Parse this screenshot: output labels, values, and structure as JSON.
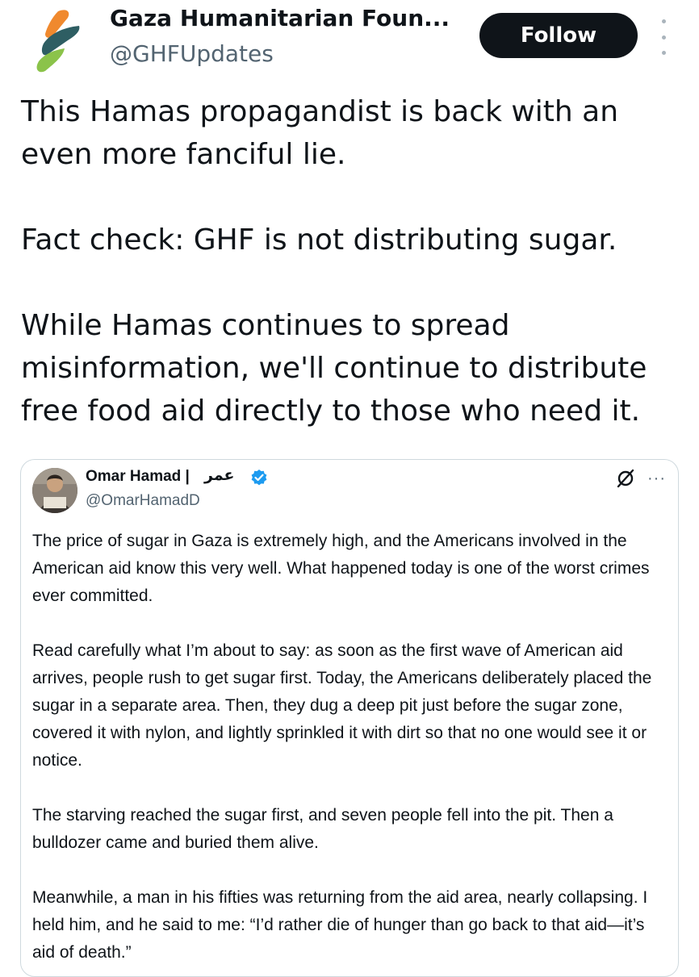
{
  "post": {
    "author": {
      "name": "Gaza Humanitarian Foun...",
      "handle": "@GHFUpdates"
    },
    "follow_label": "Follow",
    "paragraphs": [
      "This Hamas propagandist is back with an even more fanciful lie.",
      "Fact check: GHF is not distributing sugar.",
      "While Hamas continues to spread misinformation, we'll continue to distribute free food aid directly to those who need it."
    ]
  },
  "quoted": {
    "author": {
      "name": "Omar Hamad |",
      "name_arabic": "عمر",
      "handle": "@OmarHamadD"
    },
    "more_label": "···",
    "paragraphs": [
      "The price of sugar in Gaza is extremely high, and the Americans involved in the American aid know this very well. What happened today is one of the worst crimes ever committed.",
      "Read carefully what I’m about to say: as soon as the first wave of American aid arrives, people rush to get sugar first. Today, the Americans deliberately placed the sugar in a separate area. Then, they dug a deep pit just before the sugar zone, covered it with nylon, and lightly sprinkled it with dirt so that no one would see it or notice.",
      "The starving reached the sugar first, and seven people fell into the pit. Then a bulldozer came and buried them alive.",
      "Meanwhile, a man in his fifties was returning from the aid area, nearly collapsing. I held him, and he said to me: “I’d rather die of hunger than go back to that aid—it’s aid of death.”"
    ]
  },
  "colors": {
    "primary_text": "#0f1419",
    "secondary_text": "#536471",
    "verified_blue": "#1d9bf0",
    "logo_orange": "#f0892e",
    "logo_teal": "#2e5e63",
    "logo_green": "#8bc34a"
  },
  "icons": [
    "ghf-logo-icon",
    "more-vertical-icon",
    "verified-badge-icon",
    "grok-icon",
    "more-horizontal-icon"
  ]
}
